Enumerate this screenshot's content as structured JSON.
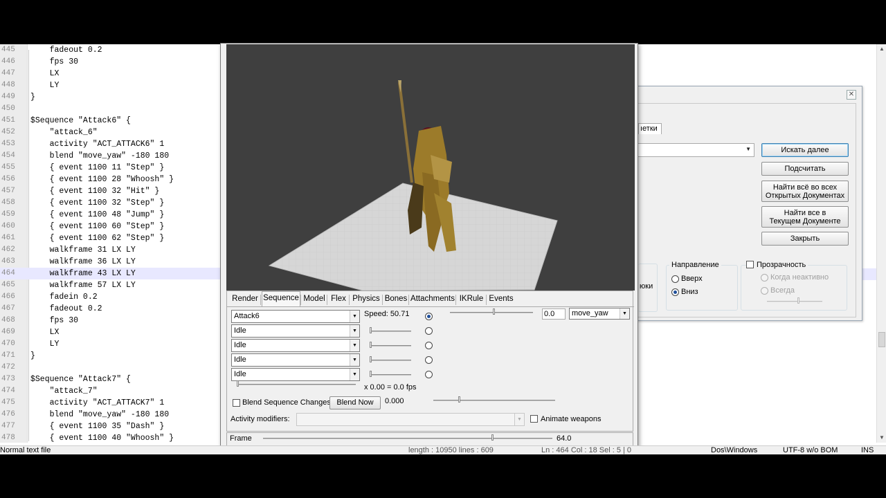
{
  "editor": {
    "lines": [
      {
        "n": "445",
        "t": "    fadeout 0.2"
      },
      {
        "n": "446",
        "t": "    fps 30"
      },
      {
        "n": "447",
        "t": "    LX"
      },
      {
        "n": "448",
        "t": "    LY"
      },
      {
        "n": "449",
        "t": "}"
      },
      {
        "n": "450",
        "t": ""
      },
      {
        "n": "451",
        "t": "$Sequence \"Attack6\" {"
      },
      {
        "n": "452",
        "t": "    \"attack_6\""
      },
      {
        "n": "453",
        "t": "    activity \"ACT_ATTACK6\" 1"
      },
      {
        "n": "454",
        "t": "    blend \"move_yaw\" -180 180"
      },
      {
        "n": "455",
        "t": "    { event 1100 11 \"Step\" }"
      },
      {
        "n": "456",
        "t": "    { event 1100 28 \"Whoosh\" }"
      },
      {
        "n": "457",
        "t": "    { event 1100 32 \"Hit\" }"
      },
      {
        "n": "458",
        "t": "    { event 1100 32 \"Step\" }"
      },
      {
        "n": "459",
        "t": "    { event 1100 48 \"Jump\" }"
      },
      {
        "n": "460",
        "t": "    { event 1100 60 \"Step\" }"
      },
      {
        "n": "461",
        "t": "    { event 1100 62 \"Step\" }"
      },
      {
        "n": "462",
        "t": "    walkframe 31 LX LY"
      },
      {
        "n": "463",
        "t": "    walkframe 36 LX LY"
      },
      {
        "n": "464",
        "t": "    walkframe 43 LX LY"
      },
      {
        "n": "465",
        "t": "    walkframe 57 LX LY"
      },
      {
        "n": "466",
        "t": "    fadein 0.2"
      },
      {
        "n": "467",
        "t": "    fadeout 0.2"
      },
      {
        "n": "468",
        "t": "    fps 30"
      },
      {
        "n": "469",
        "t": "    LX"
      },
      {
        "n": "470",
        "t": "    LY"
      },
      {
        "n": "471",
        "t": "}"
      },
      {
        "n": "472",
        "t": ""
      },
      {
        "n": "473",
        "t": "$Sequence \"Attack7\" {"
      },
      {
        "n": "474",
        "t": "    \"attack_7\""
      },
      {
        "n": "475",
        "t": "    activity \"ACT_ATTACK7\" 1"
      },
      {
        "n": "476",
        "t": "    blend \"move_yaw\" -180 180"
      },
      {
        "n": "477",
        "t": "    { event 1100 35 \"Dash\" }"
      },
      {
        "n": "478",
        "t": "    { event 1100 40 \"Whoosh\" }"
      }
    ],
    "active_line": "464"
  },
  "statusbar": {
    "file_type": "Normal text file",
    "length": "length : 10950    lines : 609",
    "position": "Ln : 464    Col : 18    Sel : 5 | 0",
    "eol": "Dos\\Windows",
    "encoding": "UTF-8 w/o BOM",
    "mode": "INS"
  },
  "find_dialog": {
    "tab_label": "ıетки",
    "btn_find_next": "Искать далее",
    "btn_count": "Подсчитать",
    "btn_find_all_open_1": "Найти всё во всех",
    "btn_find_all_open_2": "Открытых Документах",
    "btn_find_all_current_1": "Найти все в",
    "btn_find_all_current_2": "Текущем Документе",
    "btn_close": "Закрыть",
    "direction_title": "Направление",
    "dir_up": "Вверх",
    "dir_down": "Вниз",
    "transparency": "Прозрачность",
    "when_inactive": "Когда неактивно",
    "always": "Всегда",
    "partial_label": "юки"
  },
  "hlmv": {
    "tabs": [
      "Render",
      "Sequence",
      "Model",
      "Flex",
      "Physics",
      "Bones",
      "Attachments",
      "IKRule",
      "Events"
    ],
    "active_tab": "Sequence",
    "sequences": [
      "Attack6",
      "Idle",
      "Idle",
      "Idle",
      "Idle"
    ],
    "speed_label": "Speed: 50.71",
    "pose_value": "0.0",
    "pose_param": "move_yaw",
    "fps_text": "x 0.00 = 0.0 fps",
    "blend_changes": "Blend Sequence Changes",
    "blend_now": "Blend Now",
    "blend_value": "0.000",
    "activity_modifiers": "Activity modifiers:",
    "animate_weapons": "Animate weapons",
    "frame_label": "Frame",
    "frame_value": "64.0",
    "frame_position": 0.79
  },
  "colors": {
    "viewport_bg": "#3f3f3f",
    "ground": "#d9d9d9",
    "armor": "#9c7b2a",
    "cape": "#5a1020"
  }
}
